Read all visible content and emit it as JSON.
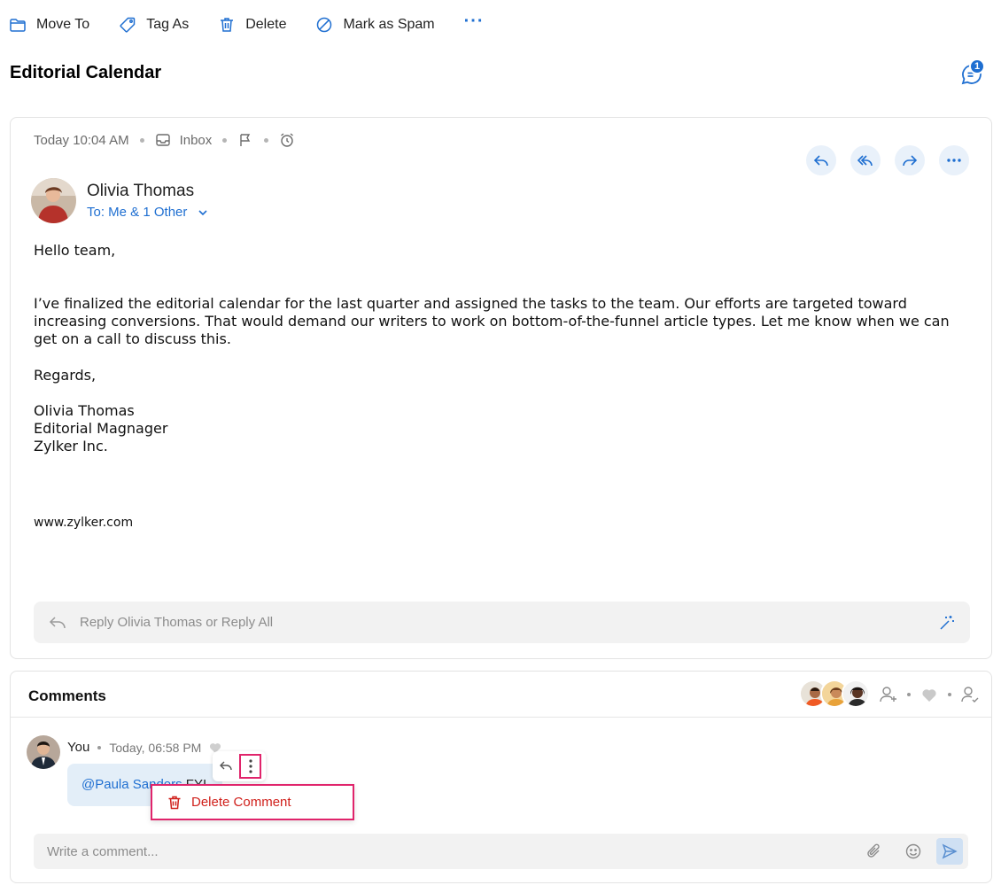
{
  "toolbar": {
    "move_to": "Move To",
    "tag_as": "Tag As",
    "delete": "Delete",
    "mark_spam": "Mark as Spam",
    "more": "···"
  },
  "page": {
    "title": "Editorial Calendar",
    "chat_badge_count": "1"
  },
  "mail": {
    "time": "Today 10:04 AM",
    "folder": "Inbox",
    "sender": "Olivia Thomas",
    "to": "To: Me & 1 Other",
    "greeting": "Hello team,",
    "paragraph": "I’ve finalized the editorial calendar for the last quarter and assigned the tasks to the team. Our efforts are targeted toward increasing conversions. That would demand our writers to work on bottom-of-the-funnel article types. Let me know when we can get on a call to discuss this.",
    "regards": "Regards,",
    "signature": "Olivia Thomas\nEditorial Magnager\nZylker Inc.",
    "website": "www.zylker.com",
    "reply_placeholder": "Reply Olivia Thomas or Reply All"
  },
  "comments": {
    "title": "Comments",
    "author": "You",
    "time": "Today, 06:58 PM",
    "mention": "@Paula Sanders",
    "text_rest": " FYI",
    "menu_delete": "Delete Comment",
    "input_placeholder": "Write a comment..."
  },
  "colors": {
    "accent": "#1f6fd1",
    "danger": "#d0211c",
    "highlight": "#e0246b"
  }
}
